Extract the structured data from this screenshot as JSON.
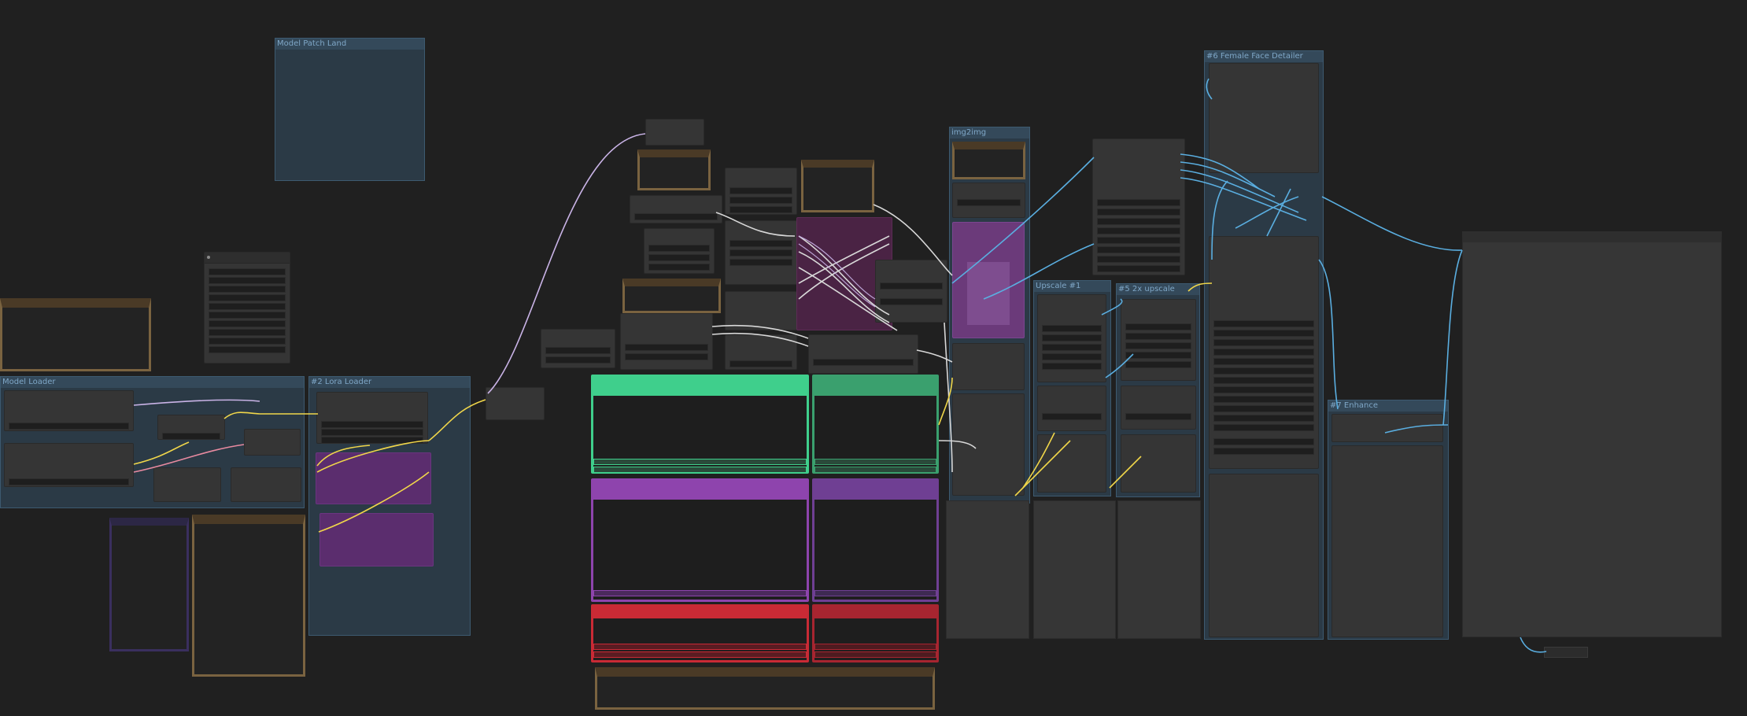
{
  "groups": {
    "model_patch_land": "Model Patch Land",
    "model_loader": "Model Loader",
    "lora_loader": "#2 Lora Loader",
    "img2img": "img2img",
    "upscale1": "Upscale #1",
    "upscale2x": "#5 2x upscale",
    "face_detailer": "#6 Female Face Detailer",
    "enhance": "#7 Enhance"
  },
  "colors": {
    "background": "#202020",
    "group_fill": "#2b3a46",
    "group_title": "#7fa7c7",
    "green": "#3fcf8c",
    "purple": "#8e44ad",
    "red": "#c92a35",
    "wire_blue": "#5aaee0",
    "wire_yellow": "#f0d64a",
    "wire_lavender": "#c9b3e6",
    "wire_pink": "#e88aa0",
    "wire_white": "#d8d8d8"
  },
  "icons": {
    "node_collapse": "dot-icon",
    "pin": "pin-icon"
  }
}
